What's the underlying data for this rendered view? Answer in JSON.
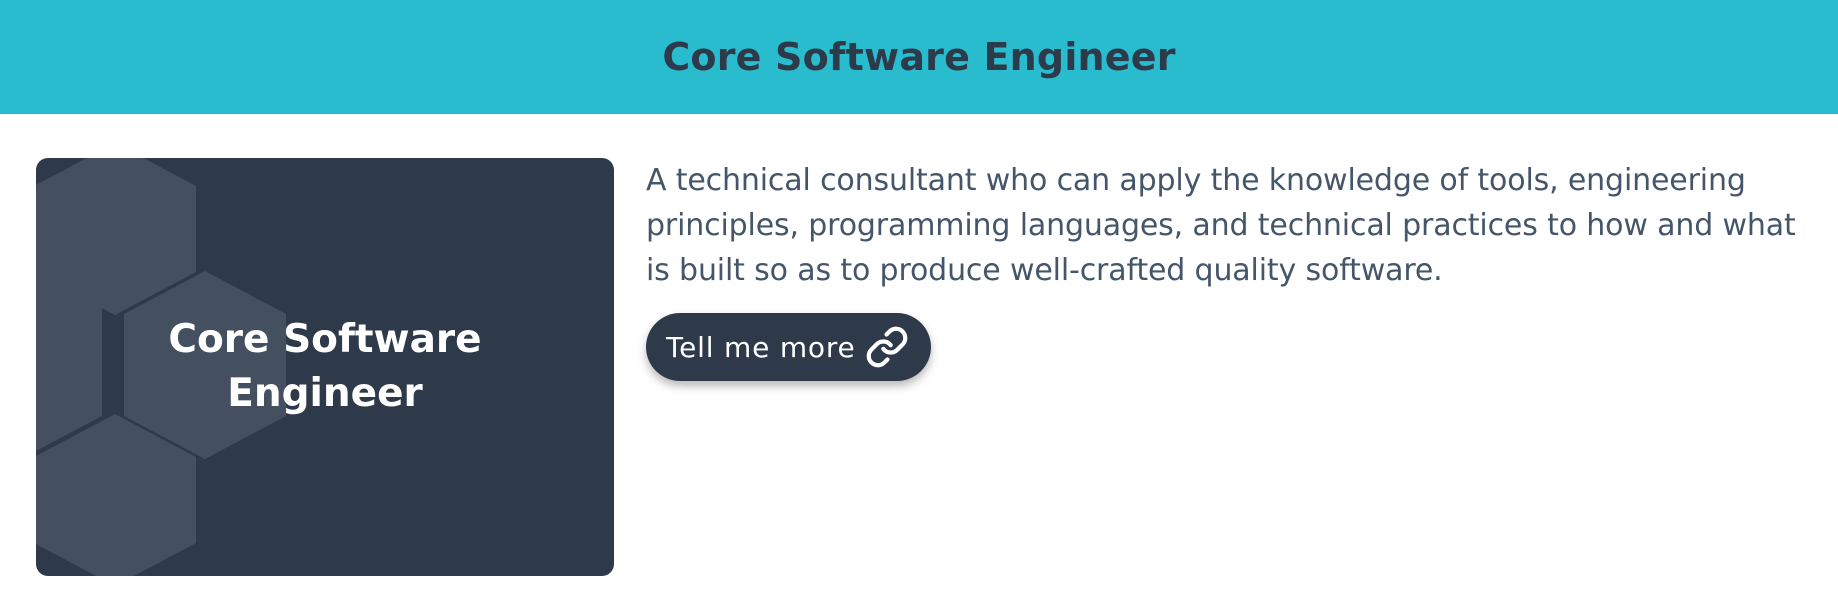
{
  "header": {
    "title": "Core Software Engineer",
    "background_color": "#29bccf"
  },
  "card": {
    "title": "Core Software Engineer",
    "background_color": "#2e3a4a",
    "pattern": "hexagon-pattern"
  },
  "description": "A technical consultant who can apply the knowledge of tools, engineering principles, programming languages, and technical practices to how and what is built so as to produce well-crafted quality software.",
  "cta": {
    "label": "Tell me more",
    "icon": "link-icon"
  }
}
